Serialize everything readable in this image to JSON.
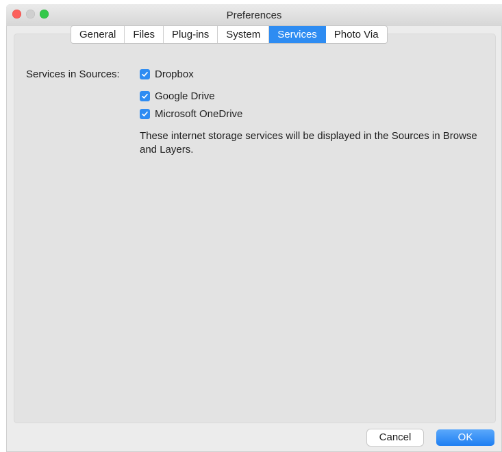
{
  "window": {
    "title": "Preferences"
  },
  "tabs": [
    {
      "label": "General",
      "active": false
    },
    {
      "label": "Files",
      "active": false
    },
    {
      "label": "Plug-ins",
      "active": false
    },
    {
      "label": "System",
      "active": false
    },
    {
      "label": "Services",
      "active": true
    },
    {
      "label": "Photo Via",
      "active": false
    }
  ],
  "services": {
    "section_label": "Services in Sources:",
    "options": [
      {
        "label": "Dropbox",
        "checked": true
      },
      {
        "label": "Google Drive",
        "checked": true
      },
      {
        "label": "Microsoft OneDrive",
        "checked": true
      }
    ],
    "description": "These internet storage services will be displayed in the Sources in Browse and Layers."
  },
  "buttons": {
    "cancel": "Cancel",
    "ok": "OK"
  },
  "colors": {
    "accent": "#2e8cf2",
    "panel": "#e3e3e3",
    "window": "#ececec"
  }
}
